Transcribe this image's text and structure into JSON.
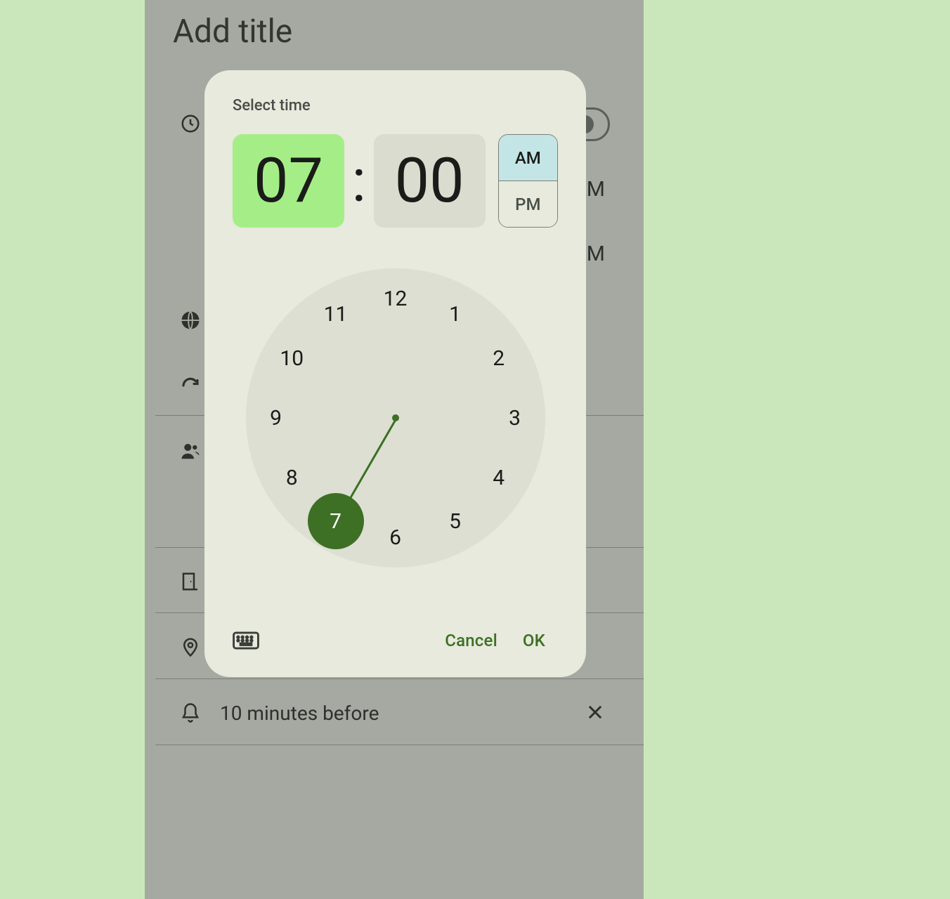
{
  "background": {
    "title": "Add title",
    "time_right1": "AM",
    "time_right2": "PM",
    "notification_text": "10 minutes before"
  },
  "modal": {
    "title": "Select time",
    "hour": "07",
    "minute": "00",
    "am_label": "AM",
    "pm_label": "PM",
    "selected_period": "AM",
    "selected_hour": 7,
    "clock_numbers": [
      "12",
      "1",
      "2",
      "3",
      "4",
      "5",
      "6",
      "7",
      "8",
      "9",
      "10",
      "11"
    ],
    "cancel_label": "Cancel",
    "ok_label": "OK"
  }
}
